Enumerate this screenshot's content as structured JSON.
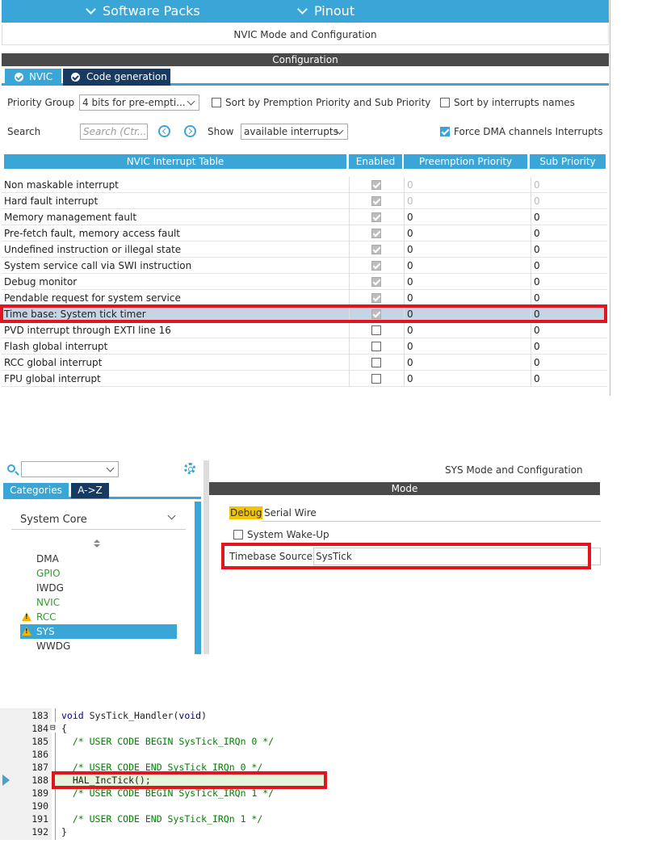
{
  "panel1": {
    "topbar": {
      "software_packs": "Software Packs",
      "pinout": "Pinout"
    },
    "subtitle": "NVIC Mode and Configuration",
    "config_header": "Configuration",
    "tabs": {
      "nvic": "NVIC",
      "code_generation": "Code generation"
    },
    "priority_group": {
      "label": "Priority Group",
      "value": "4 bits for pre-empti..."
    },
    "sort_premption": {
      "label": "Sort by Premption Priority and Sub Priority",
      "checked": false
    },
    "sort_names": {
      "label": "Sort by interrupts names",
      "checked": false
    },
    "search": {
      "label": "Search",
      "placeholder": "Search (Ctr..."
    },
    "show": {
      "label": "Show",
      "value": "available interrupts"
    },
    "force_dma": {
      "label": "Force DMA channels Interrupts",
      "checked": true
    },
    "table": {
      "headers": [
        "NVIC Interrupt Table",
        "Enabled",
        "Preemption Priority",
        "Sub Priority"
      ],
      "rows": [
        {
          "name": "Non maskable interrupt",
          "enabled": true,
          "pp": "0",
          "sp": "0",
          "locked": true
        },
        {
          "name": "Hard fault interrupt",
          "enabled": true,
          "pp": "0",
          "sp": "0",
          "locked": true
        },
        {
          "name": "Memory management fault",
          "enabled": true,
          "pp": "0",
          "sp": "0",
          "locked": false
        },
        {
          "name": "Pre-fetch fault, memory access fault",
          "enabled": true,
          "pp": "0",
          "sp": "0",
          "locked": false
        },
        {
          "name": "Undefined instruction or illegal state",
          "enabled": true,
          "pp": "0",
          "sp": "0",
          "locked": false
        },
        {
          "name": "System service call via SWI instruction",
          "enabled": true,
          "pp": "0",
          "sp": "0",
          "locked": false
        },
        {
          "name": "Debug monitor",
          "enabled": true,
          "pp": "0",
          "sp": "0",
          "locked": false
        },
        {
          "name": "Pendable request for system service",
          "enabled": true,
          "pp": "0",
          "sp": "0",
          "locked": false
        },
        {
          "name": "Time base: System tick timer",
          "enabled": true,
          "pp": "0",
          "sp": "0",
          "locked": false,
          "selected": true
        },
        {
          "name": "PVD interrupt through EXTI line 16",
          "enabled": false,
          "pp": "0",
          "sp": "0",
          "locked": false
        },
        {
          "name": "Flash global interrupt",
          "enabled": false,
          "pp": "0",
          "sp": "0",
          "locked": false
        },
        {
          "name": "RCC global interrupt",
          "enabled": false,
          "pp": "0",
          "sp": "0",
          "locked": false
        },
        {
          "name": "FPU global interrupt",
          "enabled": false,
          "pp": "0",
          "sp": "0",
          "locked": false
        }
      ]
    }
  },
  "panel2": {
    "search_value": "",
    "tabs": {
      "categories": "Categories",
      "atoz": "A->Z"
    },
    "category": "System Core",
    "items": [
      {
        "label": "DMA",
        "color": "#333333",
        "warning": false,
        "selected": false
      },
      {
        "label": "GPIO",
        "color": "#2e9e2e",
        "warning": false,
        "selected": false
      },
      {
        "label": "IWDG",
        "color": "#333333",
        "warning": false,
        "selected": false
      },
      {
        "label": "NVIC",
        "color": "#2e9e2e",
        "warning": false,
        "selected": false
      },
      {
        "label": "RCC",
        "color": "#2e9e2e",
        "warning": true,
        "selected": false
      },
      {
        "label": "SYS",
        "color": "#ffffff",
        "warning": true,
        "selected": true
      },
      {
        "label": "WWDG",
        "color": "#333333",
        "warning": false,
        "selected": false
      }
    ],
    "title": "SYS Mode and Configuration",
    "mode_header": "Mode",
    "debug": {
      "label": "Debug",
      "value": "Serial Wire"
    },
    "wakeup": {
      "label": "System Wake-Up",
      "checked": false
    },
    "timebase": {
      "label": "Timebase Source",
      "value": "SysTick"
    }
  },
  "panel3": {
    "lines": [
      {
        "num": "183",
        "fold": "",
        "parts": [
          [
            "kw",
            "void"
          ],
          [
            "tx",
            " SysTick_Handler("
          ],
          [
            "kw",
            "void"
          ],
          [
            "tx",
            ")"
          ]
        ]
      },
      {
        "num": "184",
        "fold": "⊟",
        "parts": [
          [
            "tx",
            "{"
          ]
        ]
      },
      {
        "num": "185",
        "fold": "",
        "parts": [
          [
            "tx",
            "  "
          ],
          [
            "cm",
            "/* USER CODE BEGIN SysTick_IRQn 0 */"
          ]
        ]
      },
      {
        "num": "186",
        "fold": "",
        "parts": []
      },
      {
        "num": "187",
        "fold": "",
        "parts": [
          [
            "tx",
            "  "
          ],
          [
            "cm",
            "/* USER CODE END SysTick_IRQn 0 */"
          ]
        ]
      },
      {
        "num": "188",
        "fold": "",
        "parts": [
          [
            "tx",
            "  HAL_IncTick();"
          ]
        ],
        "current": true
      },
      {
        "num": "189",
        "fold": "",
        "parts": [
          [
            "tx",
            "  "
          ],
          [
            "cm",
            "/* USER CODE BEGIN SysTick_IRQn 1 */"
          ]
        ]
      },
      {
        "num": "190",
        "fold": "",
        "parts": []
      },
      {
        "num": "191",
        "fold": "",
        "parts": [
          [
            "tx",
            "  "
          ],
          [
            "cm",
            "/* USER CODE END SysTick_IRQn 1 */"
          ]
        ]
      },
      {
        "num": "192",
        "fold": "",
        "parts": [
          [
            "tx",
            "}"
          ]
        ]
      }
    ]
  },
  "colors": {
    "accent": "#3aa6d8",
    "dark_tab": "#173a63",
    "highlight": "#e0151d",
    "warning": "#f2b400"
  }
}
